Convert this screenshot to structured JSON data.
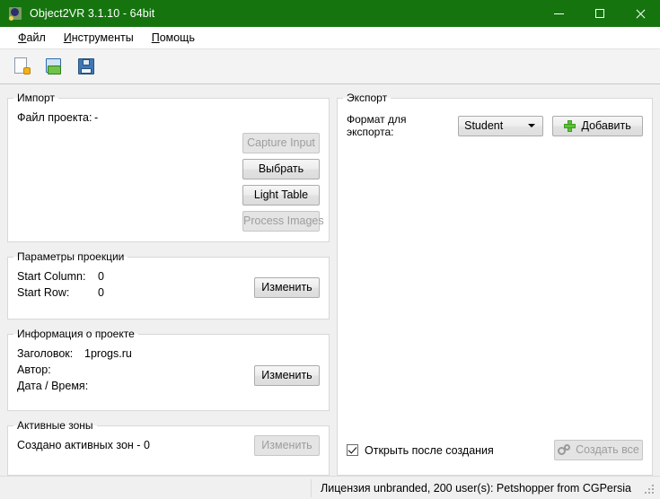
{
  "window": {
    "title": "Object2VR 3.1.10 - 64bit",
    "app_icon": "object2vr-app-icon",
    "titlebar_color": "#15740e",
    "controls": {
      "minimize": "minimize-icon",
      "maximize": "maximize-icon",
      "close": "close-icon"
    }
  },
  "menubar": {
    "items": [
      {
        "label": "Файл",
        "accel": "Ф",
        "rest": "айл"
      },
      {
        "label": "Инструменты",
        "accel": "И",
        "rest": "нструменты"
      },
      {
        "label": "Помощь",
        "accel": "П",
        "rest": "омощь"
      }
    ]
  },
  "toolbar": {
    "buttons": [
      {
        "name": "new-project-button",
        "icon": "new-document-icon"
      },
      {
        "name": "open-project-button",
        "icon": "open-folder-icon"
      },
      {
        "name": "save-project-button",
        "icon": "save-floppy-icon"
      }
    ]
  },
  "import": {
    "legend": "Импорт",
    "project_file_label": "Файл проекта:",
    "project_file_value": "-",
    "buttons": [
      {
        "label": "Capture Input",
        "enabled": false
      },
      {
        "label": "Выбрать",
        "enabled": true
      },
      {
        "label": "Light Table",
        "enabled": true
      },
      {
        "label": "Process Images",
        "enabled": false
      }
    ]
  },
  "projection": {
    "legend": "Параметры проекции",
    "rows": [
      {
        "label": "Start Column:",
        "value": "0"
      },
      {
        "label": "Start Row:",
        "value": "0"
      }
    ],
    "edit_button": {
      "label": "Изменить",
      "enabled": true
    }
  },
  "project_info": {
    "legend": "Информация о проекте",
    "rows": [
      {
        "label": "Заголовок:",
        "value": "1progs.ru"
      },
      {
        "label": "Автор:",
        "value": ""
      },
      {
        "label": "Дата / Время:",
        "value": ""
      }
    ],
    "edit_button": {
      "label": "Изменить",
      "enabled": true
    }
  },
  "hotspots": {
    "legend": "Активные зоны",
    "status_text": "Создано активных зон - 0",
    "edit_button": {
      "label": "Изменить",
      "enabled": false
    }
  },
  "export": {
    "legend": "Экспорт",
    "format_label": "Формат для экспорта:",
    "format_selected": "Student",
    "format_options": [
      "Student"
    ],
    "add_button": {
      "label": "Добавить",
      "icon": "green-plus-icon",
      "enabled": true
    },
    "open_after_create": {
      "label": "Открыть после создания",
      "checked": true
    },
    "create_all_button": {
      "label": "Создать все",
      "icon": "gears-icon",
      "enabled": false
    }
  },
  "statusbar": {
    "license_text": "Лицензия unbranded, 200 user(s): Petshopper from CGPersia",
    "grip": "resize-grip-icon"
  }
}
